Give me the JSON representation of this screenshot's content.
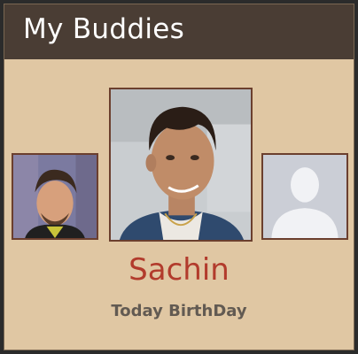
{
  "app": {
    "title": "My Buddies"
  },
  "carousel": {
    "selected": {
      "name": "Sachin",
      "subtitle": "Today BirthDay"
    }
  },
  "colors": {
    "header_bg": "#4a3d34",
    "card_bg": "#e0c7a3",
    "name_color": "#b23b2c",
    "subtitle_color": "#625a52",
    "avatar_border": "#6b3f2e"
  }
}
